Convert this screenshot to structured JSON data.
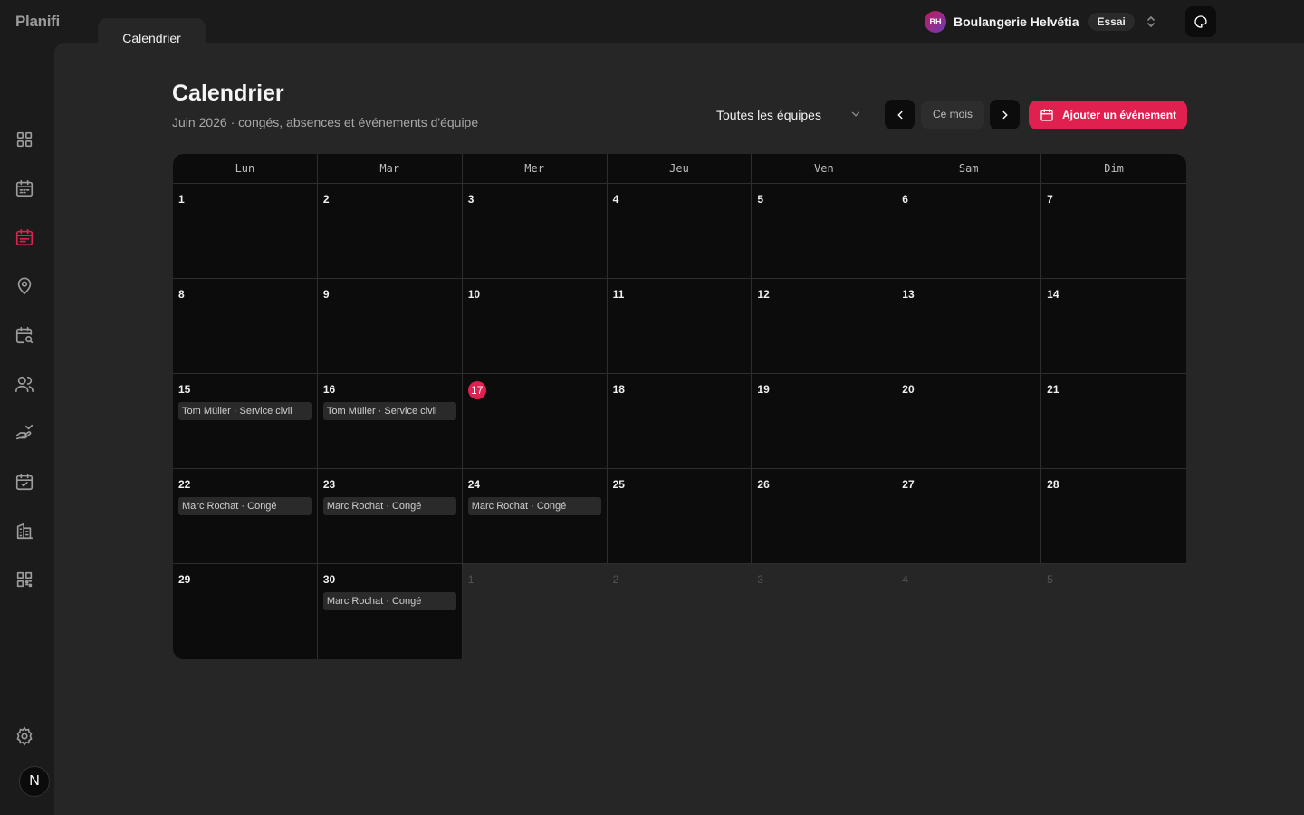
{
  "app": {
    "name": "Planifi",
    "tab_label": "Calendrier"
  },
  "org": {
    "initials": "BH",
    "name": "Boulangerie Helvétia",
    "plan_badge": "Essai"
  },
  "user": {
    "initial": "N"
  },
  "sidebar": {
    "items": [
      {
        "icon": "dashboard-icon"
      },
      {
        "icon": "calendar-schedule-icon"
      },
      {
        "icon": "calendar-icon",
        "active": true
      },
      {
        "icon": "location-pin-icon"
      },
      {
        "icon": "calendar-search-icon"
      },
      {
        "icon": "users-icon"
      },
      {
        "icon": "hand-off-icon"
      },
      {
        "icon": "calendar-check-icon"
      },
      {
        "icon": "building-icon"
      },
      {
        "icon": "qr-code-icon"
      }
    ],
    "settings_icon": "gear-icon"
  },
  "page": {
    "title": "Calendrier",
    "subtitle": "Juin 2026 · congés, absences et événements d'équipe"
  },
  "toolbar": {
    "team_filter": "Toutes les équipes",
    "this_month_label": "Ce mois",
    "add_event_label": "Ajouter un événement"
  },
  "calendar": {
    "weekdays": [
      "Lun",
      "Mar",
      "Mer",
      "Jeu",
      "Ven",
      "Sam",
      "Dim"
    ],
    "weeks": [
      [
        {
          "d": "1"
        },
        {
          "d": "2"
        },
        {
          "d": "3"
        },
        {
          "d": "4"
        },
        {
          "d": "5"
        },
        {
          "d": "6"
        },
        {
          "d": "7"
        }
      ],
      [
        {
          "d": "8"
        },
        {
          "d": "9"
        },
        {
          "d": "10"
        },
        {
          "d": "11"
        },
        {
          "d": "12"
        },
        {
          "d": "13"
        },
        {
          "d": "14"
        }
      ],
      [
        {
          "d": "15",
          "events": [
            "Tom Müller · Service civil"
          ]
        },
        {
          "d": "16",
          "events": [
            "Tom Müller · Service civil"
          ]
        },
        {
          "d": "17",
          "today": true
        },
        {
          "d": "18"
        },
        {
          "d": "19"
        },
        {
          "d": "20"
        },
        {
          "d": "21"
        }
      ],
      [
        {
          "d": "22",
          "events": [
            "Marc Rochat · Congé"
          ]
        },
        {
          "d": "23",
          "events": [
            "Marc Rochat · Congé"
          ]
        },
        {
          "d": "24",
          "events": [
            "Marc Rochat · Congé"
          ]
        },
        {
          "d": "25"
        },
        {
          "d": "26"
        },
        {
          "d": "27"
        },
        {
          "d": "28"
        }
      ],
      [
        {
          "d": "29"
        },
        {
          "d": "30",
          "events": [
            "Marc Rochat · Congé"
          ]
        },
        {
          "d": "1",
          "out": true
        },
        {
          "d": "2",
          "out": true
        },
        {
          "d": "3",
          "out": true
        },
        {
          "d": "4",
          "out": true
        },
        {
          "d": "5",
          "out": true
        }
      ]
    ]
  },
  "colors": {
    "accent": "#e0204f",
    "background": "#1b1b1b",
    "panel": "#262626",
    "cell": "#0c0c0c"
  }
}
